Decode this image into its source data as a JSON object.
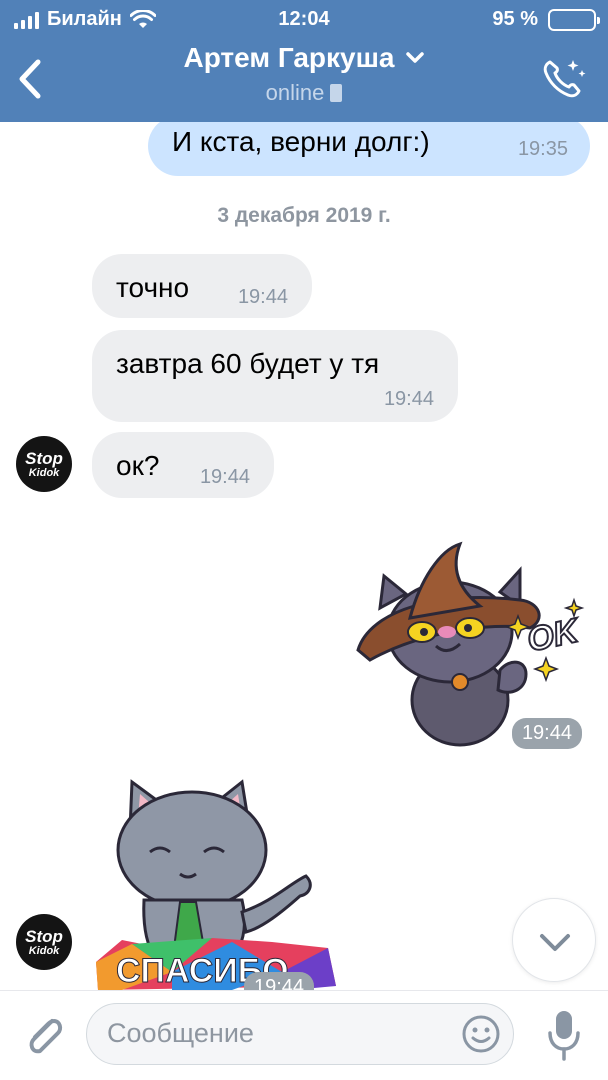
{
  "status_bar": {
    "carrier": "Билайн",
    "time": "12:04",
    "battery": "95 %",
    "battery_level": 0.95
  },
  "header": {
    "contact_name": "Артем Гаркуша",
    "status": "online"
  },
  "messages": [
    {
      "direction": "outgoing",
      "text": "И кста, верни долг:)",
      "time": "19:35"
    },
    {
      "date_separator": "3 декабря 2019 г."
    },
    {
      "direction": "incoming",
      "text": "точно",
      "time": "19:44"
    },
    {
      "direction": "incoming",
      "text": "завтра 60 будет у тя",
      "time": "19:44"
    },
    {
      "direction": "incoming",
      "text": "ок?",
      "time": "19:44"
    },
    {
      "direction": "outgoing",
      "sticker": "cat-wizard-ok",
      "sticker_text": "OK",
      "time": "19:44"
    },
    {
      "direction": "incoming",
      "sticker": "cat-thanks",
      "sticker_text": "СПАСИБО",
      "time": "19:44"
    }
  ],
  "avatar": {
    "line1": "Stop",
    "line2": "Kidok"
  },
  "composer": {
    "placeholder": "Сообщение"
  },
  "colors": {
    "header": "#5181b8",
    "outgoing_bubble": "#cce4ff",
    "incoming_bubble": "#edeef0"
  },
  "icons": [
    "back-chevron-icon",
    "chevron-down-icon",
    "call-icon",
    "paperclip-icon",
    "smile-icon",
    "microphone-icon",
    "scroll-down-icon"
  ]
}
